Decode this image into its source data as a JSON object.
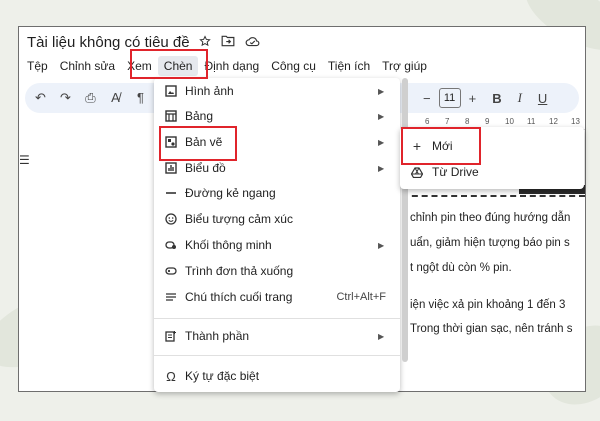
{
  "document": {
    "title": "Tài liệu không có tiêu đề",
    "icons": [
      "star-icon",
      "folder-move-icon",
      "cloud-status-icon"
    ]
  },
  "menubar": {
    "items": [
      "Tệp",
      "Chỉnh sửa",
      "Xem",
      "Chèn",
      "Định dạng",
      "Công cụ",
      "Tiện ích",
      "Trợ giúp"
    ],
    "active": "Chèn"
  },
  "toolbar": {
    "icons": [
      "undo-icon",
      "redo-icon",
      "print-icon",
      "spellcheck-icon",
      "paint-format-icon"
    ],
    "minus": "−",
    "font_size": "11",
    "plus": "+",
    "bold": "B",
    "italic": "I",
    "underline": "U"
  },
  "ruler": {
    "numbers": [
      "6",
      "7",
      "8",
      "9",
      "10",
      "11",
      "12",
      "13"
    ]
  },
  "left_mark": "☰",
  "insert_menu": {
    "items": [
      {
        "label": "Hình ảnh",
        "icon": "image-icon",
        "submenu": true
      },
      {
        "label": "Bảng",
        "icon": "table-icon",
        "submenu": true
      },
      {
        "label": "Bản vẽ",
        "icon": "drawing-icon",
        "submenu": true
      },
      {
        "label": "Biểu đồ",
        "icon": "chart-icon",
        "submenu": true
      },
      {
        "label": "Đường kẻ ngang",
        "icon": "horizontal-line-icon",
        "submenu": false
      },
      {
        "label": "Biểu tượng cảm xúc",
        "icon": "emoji-icon",
        "submenu": false
      },
      {
        "label": "Khối thông minh",
        "icon": "smart-chips-icon",
        "submenu": true
      },
      {
        "label": "Trình đơn thả xuống",
        "icon": "dropdown-icon",
        "submenu": false
      },
      {
        "label": "Chú thích cuối trang",
        "icon": "footnote-icon",
        "submenu": false,
        "shortcut": "Ctrl+Alt+F"
      },
      {
        "label": "Thành phần",
        "icon": "building-blocks-icon",
        "submenu": true
      },
      {
        "label": "Ký tự đặc biệt",
        "icon": "omega-icon",
        "submenu": false
      }
    ],
    "highlighted": "Bản vẽ"
  },
  "drawing_submenu": {
    "items": [
      {
        "label": "Mới",
        "icon": "plus-icon"
      },
      {
        "label": "Từ Drive",
        "icon": "drive-icon"
      }
    ],
    "highlighted": "Mới"
  },
  "document_text": [
    "chỉnh pin theo đúng hướng dẫn",
    "uẩn, giảm hiện tượng báo pin s",
    "t ngột dù còn % pin.",
    "iện việc xả pin khoảng 1 đến 3",
    "Trong thời gian sạc, nên tránh s"
  ],
  "colors": {
    "highlight_box": "#e0242b",
    "toolbar_bg": "#edf2fa"
  }
}
